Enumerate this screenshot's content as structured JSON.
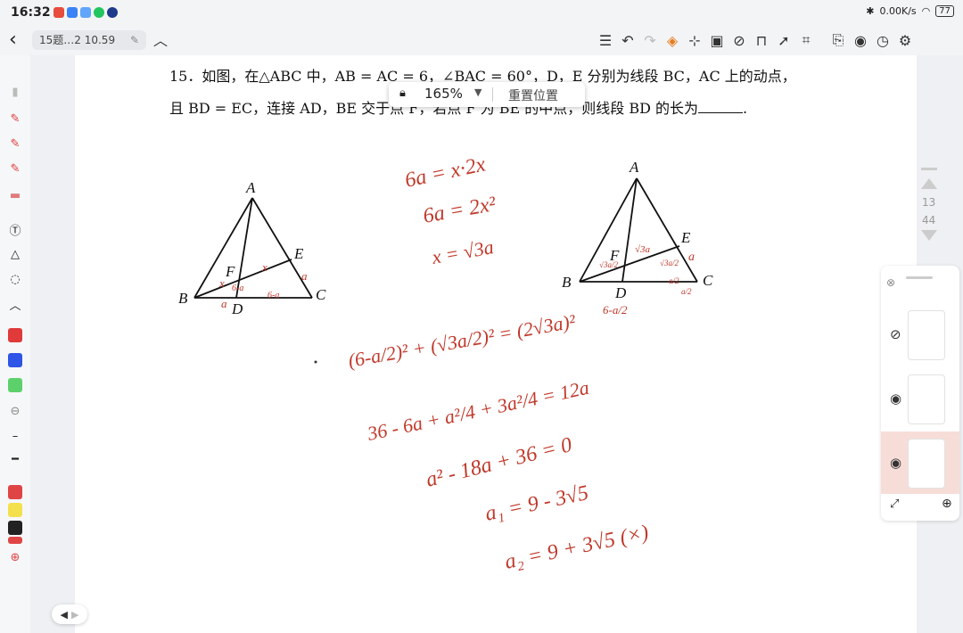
{
  "status_bar": {
    "time": "16:32",
    "net_speed": "0.00K/s",
    "battery": "77",
    "app_icon_colors": [
      "#e74c3c",
      "#3b82f6",
      "#60a5fa",
      "#22c55e",
      "#1e3a8a"
    ]
  },
  "titlebar": {
    "back_icon": "chevron-left-icon",
    "doc_name": "15题…2 10.59",
    "edit_icon": "pencil-icon",
    "collapse_icon": "chevron-up-icon",
    "tool_icons": [
      "list-icon",
      "undo-icon",
      "redo-icon",
      "layers-icon",
      "insert-icon",
      "image-icon",
      "hide-icon",
      "lock-icon",
      "pointer-icon",
      "crop-icon",
      "search-doc-icon",
      "read-mode-icon",
      "history-icon",
      "settings-icon"
    ]
  },
  "zoom_popup": {
    "zoom": "165%",
    "reset_label": "重置位置"
  },
  "problem": {
    "line1": "15．如图，在△ABC 中，AB = AC = 6，∠BAC = 60°，D，E 分别为线段 BC，AC 上的动点，",
    "line2_a": "且 BD = EC，连接 AD，BE 交于点 F，若点 F 为 BE 的中点，则线段 BD 的长为",
    "line2_b": "."
  },
  "figure_labels": {
    "A": "A",
    "B": "B",
    "C": "C",
    "D": "D",
    "E": "E",
    "F": "F"
  },
  "handwriting": {
    "color": "#c0392b",
    "left_fig_marks": [
      "x",
      "x",
      "a",
      "a",
      "6-a",
      "6-a"
    ],
    "right_fig_marks": [
      "√3a",
      "a",
      "√3a/2",
      "a/2",
      "6-a/2",
      "√3a/2",
      "a/2"
    ],
    "work_top": [
      "6a = x·2x",
      "6a = 2x²",
      "x = √3a"
    ],
    "work_bottom": [
      "(6-a/2)² + (√3a/2)² = (2√3a)²",
      "36 - 6a + a²/4 + 3a²/4 = 12a",
      "a² - 18a + 36 = 0",
      "a₁ = 9 - 3√5",
      "a₂ = 9 + 3√5  (×)"
    ]
  },
  "page_nav": {
    "current": "13",
    "total": "44"
  },
  "left_toolbar": {
    "tool_icons": [
      "highlighter-icon",
      "pen-icon",
      "pen-icon",
      "pen-icon",
      "eraser-icon",
      "text-tool-icon",
      "shapes-icon",
      "lasso-icon",
      "chevron-up-icon"
    ],
    "colors": [
      "#e03a3a",
      "#2e55e6",
      "#5cd16b",
      "#e04545",
      "#f4e04d",
      "#222222",
      "#e04545"
    ]
  },
  "layers_panel": {
    "close_icon": "close-icon",
    "rows": [
      {
        "visibility_icon": "eye-off-icon",
        "active": false
      },
      {
        "visibility_icon": "eye-icon",
        "active": false
      },
      {
        "visibility_icon": "eye-icon",
        "active": true
      }
    ],
    "expand_icon": "expand-icon",
    "add_icon": "plus-icon"
  }
}
